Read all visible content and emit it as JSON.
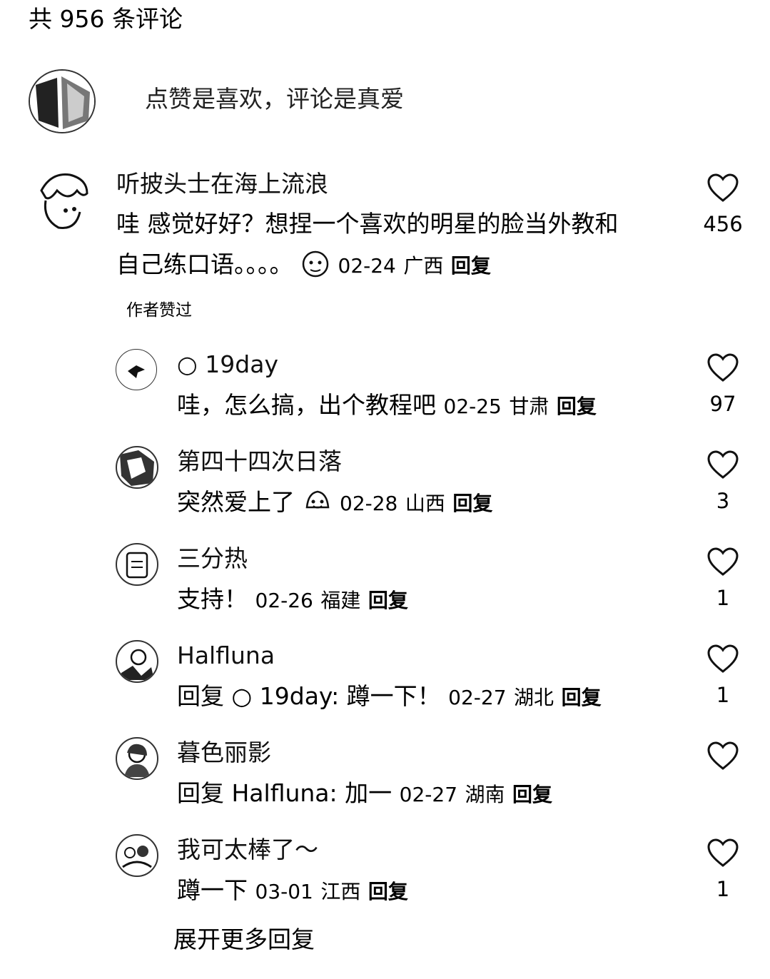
{
  "header": {
    "title": "共 956 条评论"
  },
  "compose": {
    "placeholder": "点赞是喜欢，评论是真爱"
  },
  "comment": {
    "username": "听披头士在海上流浪",
    "line1": "哇 感觉好好？想捏一个喜欢的明星的脸当外教和",
    "line2": "自己练口语。。。。",
    "date": "02-24",
    "region": "广西",
    "reply_label": "回复",
    "likes": "456",
    "author_badge": "作者赞过"
  },
  "replies": [
    {
      "username": "○ 19day",
      "text": "哇，怎么搞，出个教程吧",
      "date": "02-25",
      "region": "甘肃",
      "reply_label": "回复",
      "likes": "97"
    },
    {
      "username": "第四十四次日落",
      "text": "突然爱上了",
      "date": "02-28",
      "region": "山西",
      "reply_label": "回复",
      "likes": "3"
    },
    {
      "username": "三分热",
      "text": "支持！",
      "date": "02-26",
      "region": "福建",
      "reply_label": "回复",
      "likes": "1"
    },
    {
      "username": "Halfluna",
      "text": "回复 ○ 19day: 蹲一下！",
      "date": "02-27",
      "region": "湖北",
      "reply_label": "回复",
      "likes": "1"
    },
    {
      "username": "暮色丽影",
      "text": "回复 Halfluna: 加一",
      "date": "02-27",
      "region": "湖南",
      "reply_label": "回复",
      "likes": ""
    },
    {
      "username": "我可太棒了～",
      "text": "蹲一下",
      "date": "03-01",
      "region": "江西",
      "reply_label": "回复",
      "likes": "1"
    }
  ],
  "expand_more": "展开更多回复",
  "icons": {
    "like": "heart-outline-icon",
    "emoji": "sticker-emoji-icon"
  }
}
